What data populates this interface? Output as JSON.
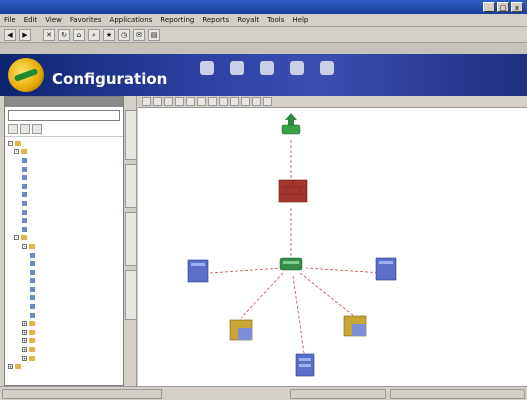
{
  "window": {
    "title": "",
    "buttons": [
      "_",
      "□",
      "x"
    ]
  },
  "menu": [
    "File",
    "Edit",
    "View",
    "Favorites",
    "Applications",
    "Reporting",
    "Reports",
    "Royalt",
    "Tools",
    "Help"
  ],
  "toolbar": {
    "label": ""
  },
  "banner": {
    "app_name": "",
    "heading": "Configuration",
    "nav": [
      {
        "label": ""
      },
      {
        "label": ""
      },
      {
        "label": ""
      },
      {
        "label": ""
      },
      {
        "label": ""
      }
    ]
  },
  "left_panel": {
    "header": "",
    "search_placeholder": "",
    "tree": [
      {
        "label": "",
        "level": 0,
        "expander": "-",
        "icon": "folder"
      },
      {
        "label": "",
        "level": 1,
        "expander": "-",
        "icon": "folder"
      },
      {
        "label": "",
        "level": 2,
        "expander": "",
        "icon": "node"
      },
      {
        "label": "",
        "level": 2,
        "expander": "",
        "icon": "node"
      },
      {
        "label": "",
        "level": 2,
        "expander": "",
        "icon": "node"
      },
      {
        "label": "",
        "level": 2,
        "expander": "",
        "icon": "node"
      },
      {
        "label": "",
        "level": 2,
        "expander": "",
        "icon": "node"
      },
      {
        "label": "",
        "level": 2,
        "expander": "",
        "icon": "node"
      },
      {
        "label": "",
        "level": 2,
        "expander": "",
        "icon": "node"
      },
      {
        "label": "",
        "level": 2,
        "expander": "",
        "icon": "node"
      },
      {
        "label": "",
        "level": 2,
        "expander": "",
        "icon": "node"
      },
      {
        "label": "",
        "level": 1,
        "expander": "-",
        "icon": "folder"
      },
      {
        "label": "",
        "level": 2,
        "expander": "-",
        "icon": "folder"
      },
      {
        "label": "",
        "level": 3,
        "expander": "",
        "icon": "node"
      },
      {
        "label": "",
        "level": 3,
        "expander": "",
        "icon": "node"
      },
      {
        "label": "",
        "level": 3,
        "expander": "",
        "icon": "node"
      },
      {
        "label": "",
        "level": 3,
        "expander": "",
        "icon": "node"
      },
      {
        "label": "",
        "level": 3,
        "expander": "",
        "icon": "node"
      },
      {
        "label": "",
        "level": 3,
        "expander": "",
        "icon": "node"
      },
      {
        "label": "",
        "level": 3,
        "expander": "",
        "icon": "node"
      },
      {
        "label": "",
        "level": 3,
        "expander": "",
        "icon": "node"
      },
      {
        "label": "",
        "level": 2,
        "expander": "+",
        "icon": "folder"
      },
      {
        "label": "",
        "level": 2,
        "expander": "+",
        "icon": "folder"
      },
      {
        "label": "",
        "level": 2,
        "expander": "+",
        "icon": "folder"
      },
      {
        "label": "",
        "level": 2,
        "expander": "+",
        "icon": "folder"
      },
      {
        "label": "",
        "level": 2,
        "expander": "+",
        "icon": "folder"
      },
      {
        "label": "",
        "level": 0,
        "expander": "+",
        "icon": "folder"
      }
    ]
  },
  "vertical_tabs": [
    "",
    "",
    "",
    ""
  ],
  "diagram": {
    "nodes": [
      {
        "id": "router",
        "label": "",
        "icon": "router-icon",
        "color": "#2e8b3a"
      },
      {
        "id": "firewall",
        "label": "",
        "icon": "firewall-icon",
        "color": "#a3362c"
      },
      {
        "id": "switch",
        "label": "",
        "icon": "switch-icon",
        "color": "#3a8c4a"
      },
      {
        "id": "server-left",
        "label": "",
        "icon": "server-icon",
        "color": "#5b6fc9"
      },
      {
        "id": "server-right",
        "label": "",
        "icon": "server-icon",
        "color": "#5b6fc9"
      },
      {
        "id": "db-left",
        "label": "",
        "icon": "database-icon",
        "color": "#c9a534"
      },
      {
        "id": "db-right",
        "label": "",
        "icon": "database-icon",
        "color": "#c9a534"
      },
      {
        "id": "storage",
        "label": "",
        "icon": "storage-icon",
        "color": "#5b6fc9"
      }
    ]
  },
  "status": [
    "",
    "",
    ""
  ]
}
